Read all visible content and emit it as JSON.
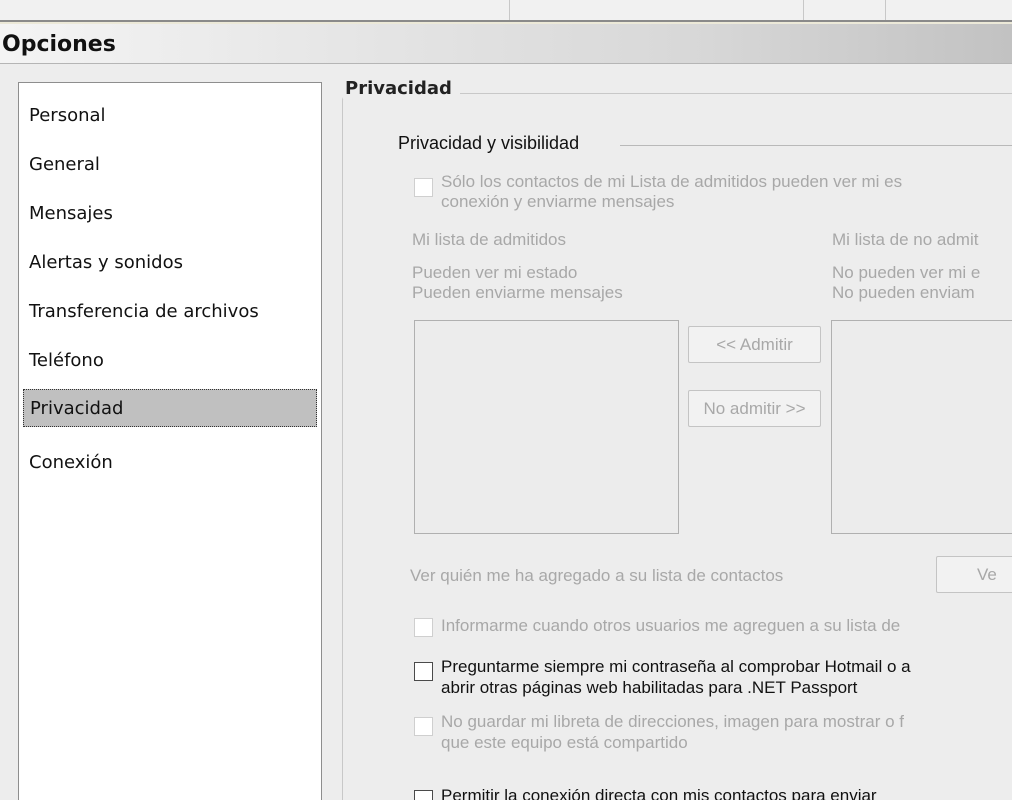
{
  "window": {
    "title": "Opciones"
  },
  "sidebar": {
    "items": [
      {
        "label": "Personal",
        "selected": false
      },
      {
        "label": "General",
        "selected": false
      },
      {
        "label": "Mensajes",
        "selected": false
      },
      {
        "label": "Alertas y sonidos",
        "selected": false
      },
      {
        "label": "Transferencia de archivos",
        "selected": false
      },
      {
        "label": "Teléfono",
        "selected": false
      },
      {
        "label": "Privacidad",
        "selected": true
      },
      {
        "label": "Conexión",
        "selected": false
      }
    ]
  },
  "privacy": {
    "group_title": "Privacidad",
    "section_title": "Privacidad y visibilidad",
    "allow_list_only": {
      "line1": "Sólo los contactos de mi Lista de admitidos pueden ver mi es",
      "line2": "conexión y enviarme mensajes",
      "checked": false,
      "enabled": false
    },
    "allow_list": {
      "title": "Mi lista de admitidos",
      "desc1": "Pueden ver mi estado",
      "desc2": "Pueden enviarme mensajes"
    },
    "block_list": {
      "title": "Mi lista de no admit",
      "desc1": "No pueden ver mi e",
      "desc2": "No pueden enviam"
    },
    "allow_button": "<< Admitir",
    "block_button": "No admitir >>",
    "view_who_added": "Ver quién me ha agregado a su lista de contactos",
    "view_button": "Ve",
    "notify_added": {
      "label": "Informarme cuando otros usuarios me agreguen a su lista de",
      "checked": false,
      "enabled": false
    },
    "ask_password": {
      "line1": "Preguntarme siempre mi contraseña al comprobar Hotmail o a",
      "line2": "abrir otras páginas web habilitadas para .NET Passport",
      "checked": false,
      "enabled": true
    },
    "dont_save_address_book": {
      "line1": "No guardar mi libreta de direcciones, imagen para mostrar o f",
      "line2": "que este equipo está compartido",
      "checked": false,
      "enabled": false
    },
    "direct_connection": {
      "line1": "Permitir la conexión directa con mis contactos para enviar",
      "checked": false,
      "enabled": true
    }
  }
}
